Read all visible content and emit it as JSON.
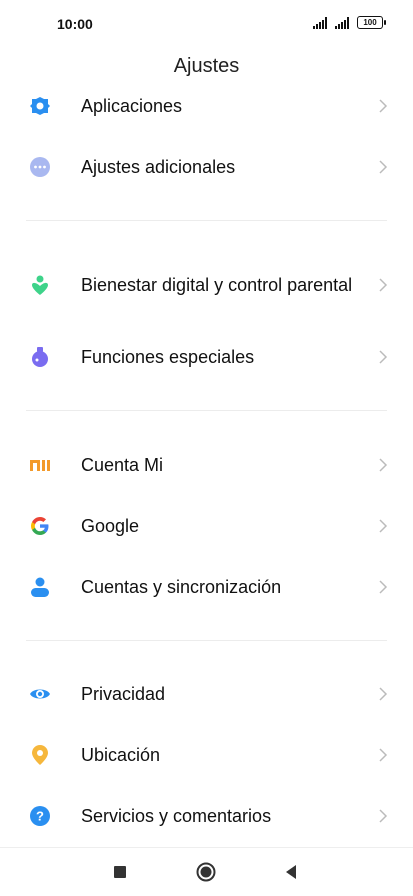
{
  "status": {
    "time": "10:00",
    "battery": "100"
  },
  "header": {
    "title": "Ajustes"
  },
  "items": [
    {
      "label": "Aplicaciones"
    },
    {
      "label": "Ajustes adicionales"
    },
    {
      "label": "Bienestar digital y control parental"
    },
    {
      "label": "Funciones especiales"
    },
    {
      "label": "Cuenta Mi"
    },
    {
      "label": "Google"
    },
    {
      "label": "Cuentas y sincronización"
    },
    {
      "label": "Privacidad"
    },
    {
      "label": "Ubicación"
    },
    {
      "label": "Servicios y comentarios"
    }
  ],
  "icons": {
    "aplicaciones": "gear-icon",
    "ajustes_adicionales": "more-dots-icon",
    "bienestar": "wellbeing-icon",
    "funciones": "flask-icon",
    "cuenta_mi": "mi-logo-icon",
    "google": "google-logo-icon",
    "cuentas": "person-icon",
    "privacidad": "eye-icon",
    "ubicacion": "location-pin-icon",
    "servicios": "help-icon"
  },
  "colors": {
    "blue": "#2a8ff0",
    "lavender": "#a9b8f0",
    "green": "#3ed38a",
    "purple": "#7a6cf0",
    "orange": "#f39a2b",
    "yellow": "#f6b73c"
  }
}
